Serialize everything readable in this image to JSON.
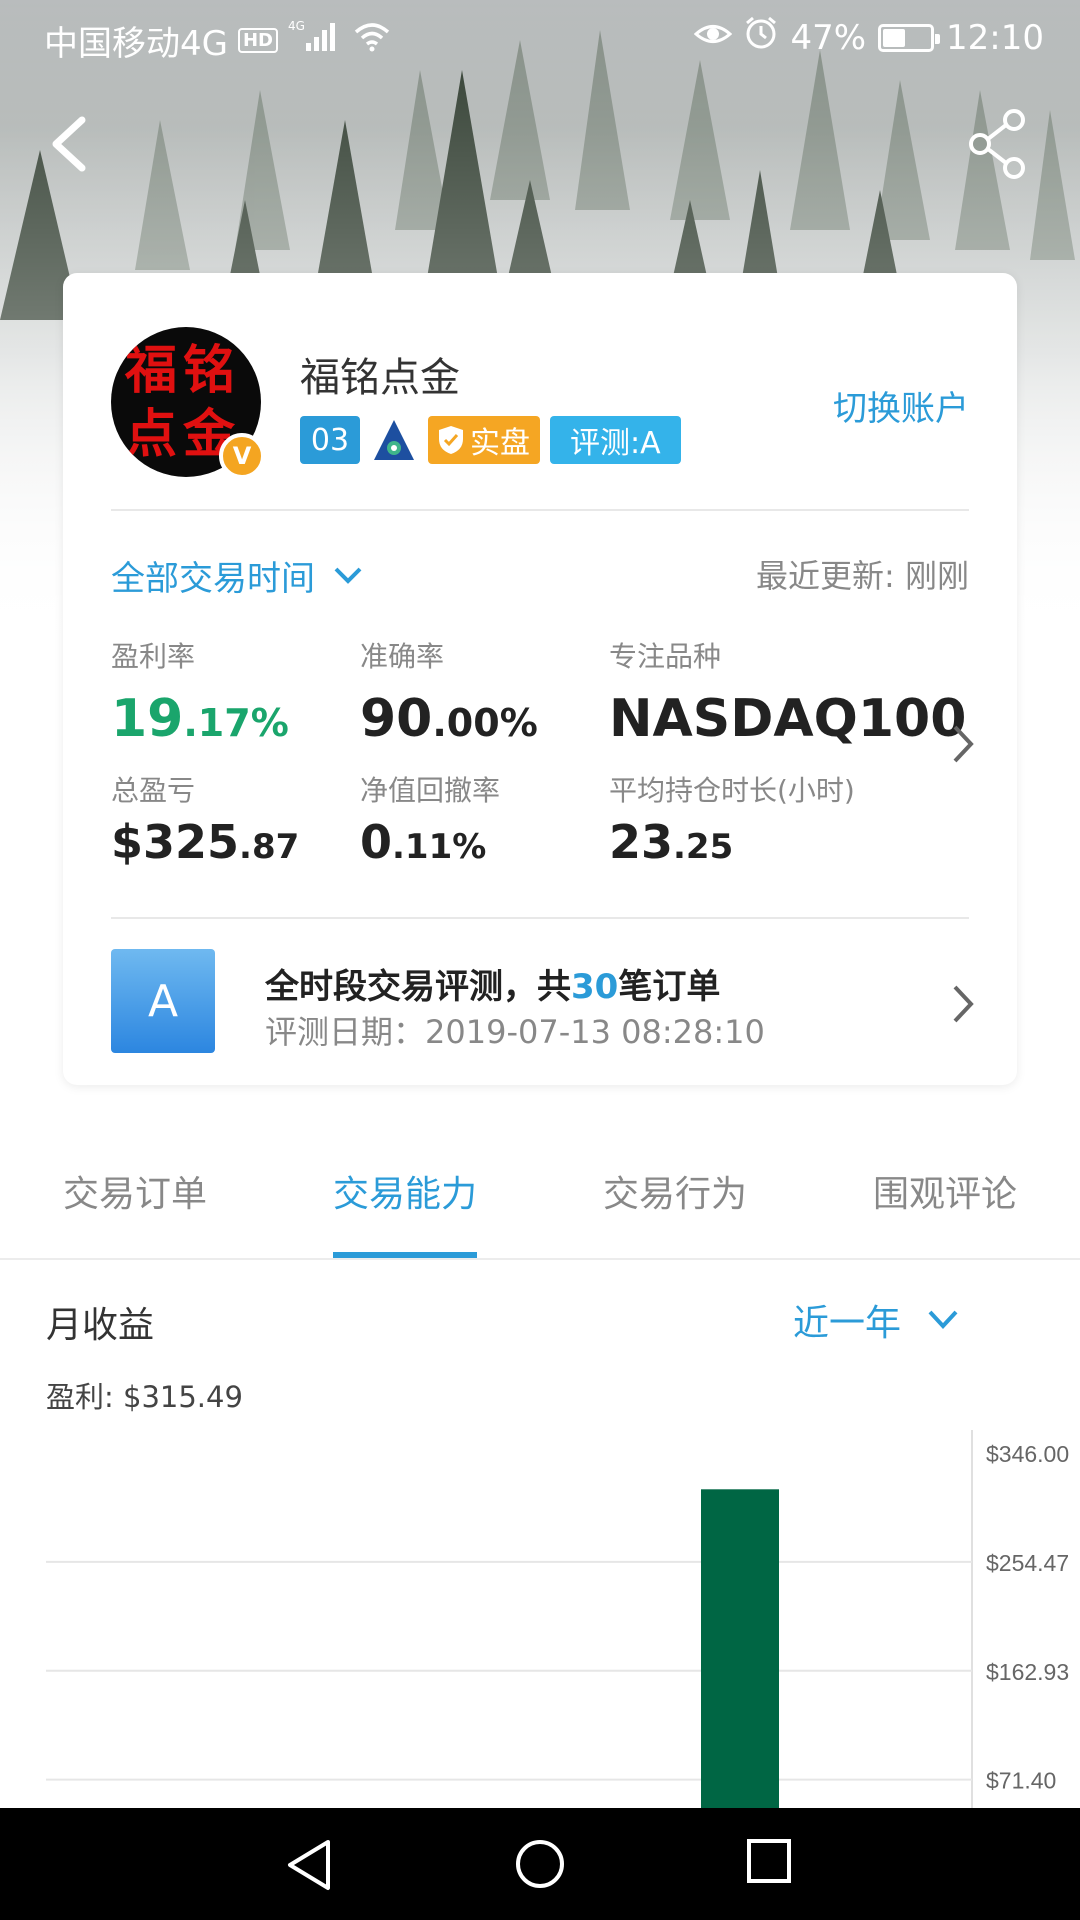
{
  "status_bar": {
    "carrier": "中国移动4G",
    "hd": "HD",
    "network": "4G",
    "battery_percent": "47%",
    "battery_level": 0.47,
    "time": "12:10"
  },
  "icons": {
    "back": "back-icon",
    "share": "share-icon",
    "chevron_down": "chevron-down-icon",
    "chevron_right": "chevron-right-icon"
  },
  "profile": {
    "avatar_text": "福铭点金",
    "avatar_badge": "V",
    "name": "福铭点金",
    "level": "03",
    "real_badge": "实盘",
    "eval_badge": "评测:A",
    "switch_account": "切换账户"
  },
  "filters": {
    "time_range": "全部交易时间",
    "updated": "最近更新: 刚刚"
  },
  "stats": {
    "profit_rate": {
      "label": "盈利率",
      "int": "19",
      "dec": ".17%"
    },
    "accuracy": {
      "label": "准确率",
      "int": "90",
      "dec": ".00%"
    },
    "focus": {
      "label": "专注品种",
      "value": "NASDAQ100"
    },
    "total_pnl": {
      "label": "总盈亏",
      "int": "$325",
      "dec": ".87"
    },
    "drawdown": {
      "label": "净值回撤率",
      "int": "0",
      "dec": ".11%"
    },
    "avg_hold": {
      "label": "平均持仓时长(小时)",
      "int": "23",
      "dec": ".25"
    }
  },
  "evaluation": {
    "grade": "A",
    "title_prefix": "全时段交易评测，共",
    "orders": "30",
    "title_suffix": "笔订单",
    "date": "评测日期：2019-07-13 08:28:10"
  },
  "tabs": [
    {
      "label": "交易订单"
    },
    {
      "label": "交易能力"
    },
    {
      "label": "交易行为"
    },
    {
      "label": "围观评论"
    }
  ],
  "active_tab": 1,
  "monthly": {
    "title": "月收益",
    "range": "近一年",
    "profit": "盈利: $315.49"
  },
  "chart_data": {
    "type": "bar",
    "y_ticks": [
      "$346.00",
      "$254.47",
      "$162.93",
      "$71.40"
    ],
    "y_tick_values": [
      346.0,
      254.47,
      162.93,
      71.4
    ],
    "ylim_visible": [
      50,
      346.0
    ],
    "values": [
      315.49
    ],
    "bar_color": "#006644",
    "grid": true
  },
  "colors": {
    "accent": "#2b9bd8",
    "profit_green": "#1aa56c",
    "real_orange": "#f5a623",
    "eval_blue": "#34b3ea"
  }
}
